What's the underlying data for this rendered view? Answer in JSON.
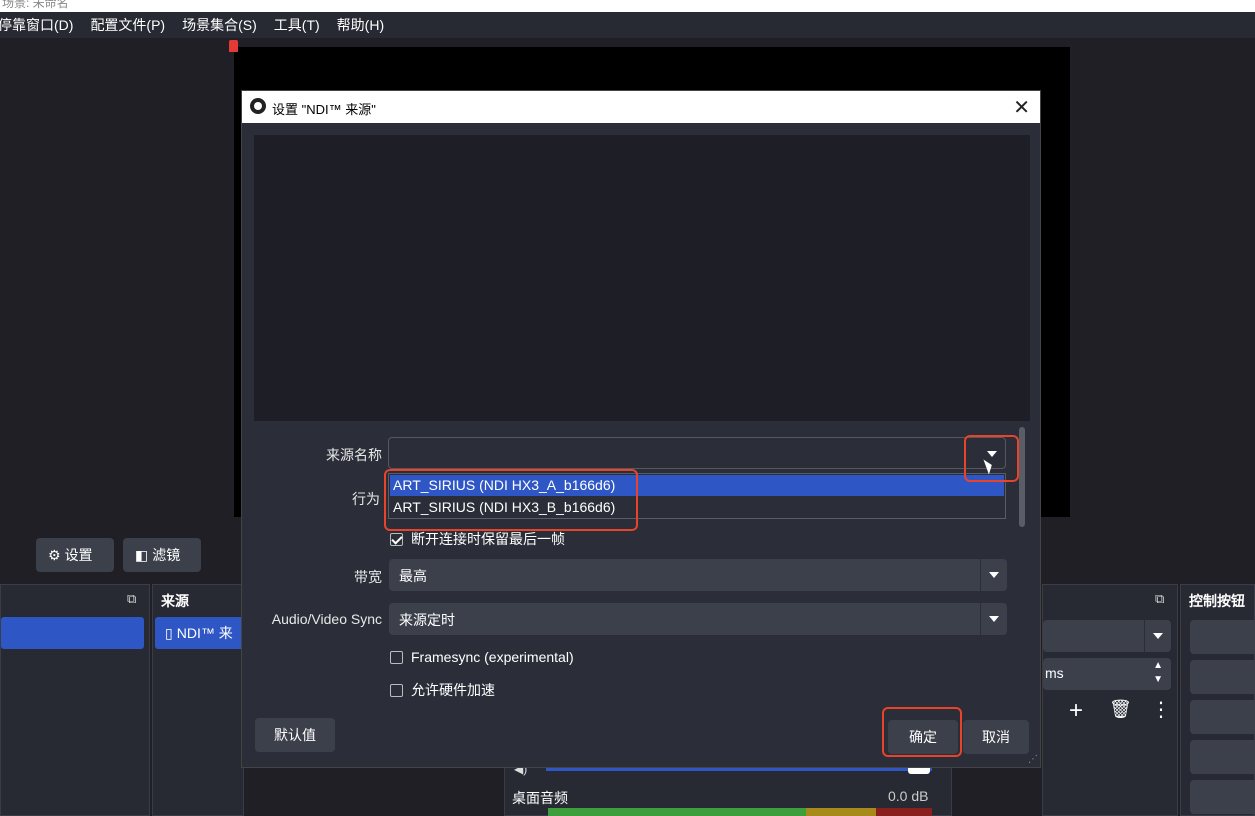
{
  "window": {
    "title": "场景: 未命名"
  },
  "menu": [
    "停靠窗口(D)",
    "配置文件(P)",
    "场景集合(S)",
    "工具(T)",
    "帮助(H)"
  ],
  "context_toolbar": {
    "settings_label": "设置",
    "filters_label": "滤镜"
  },
  "docks": {
    "sources_title": "来源",
    "source_item": "NDI™ 来",
    "controls_title": "控制按钮",
    "transition_duration_suffix": "ms"
  },
  "mixer": {
    "channel_name": "桌面音频",
    "level": "0.0 dB"
  },
  "dialog": {
    "title": "设置 \"NDI™ 来源\"",
    "fields": {
      "source_name_label": "来源名称",
      "behavior_label": "行为",
      "keep_last_frame_label": "断开连接时保留最后一帧",
      "keep_last_frame_checked": true,
      "bandwidth_label": "带宽",
      "bandwidth_value": "最高",
      "av_sync_label": "Audio/Video Sync",
      "av_sync_value": "来源定时",
      "framesync_label": "Framesync (experimental)",
      "framesync_checked": false,
      "hw_accel_label": "允许硬件加速",
      "hw_accel_checked": false
    },
    "dropdown_options": [
      "ART_SIRIUS (NDI HX3_A_b166d6)",
      "ART_SIRIUS (NDI HX3_B_b166d6)"
    ],
    "buttons": {
      "defaults": "默认值",
      "ok": "确定",
      "cancel": "取消"
    }
  },
  "colors": {
    "accent": "#2f56c5",
    "highlight": "#e8432b",
    "panel": "#272a33"
  }
}
